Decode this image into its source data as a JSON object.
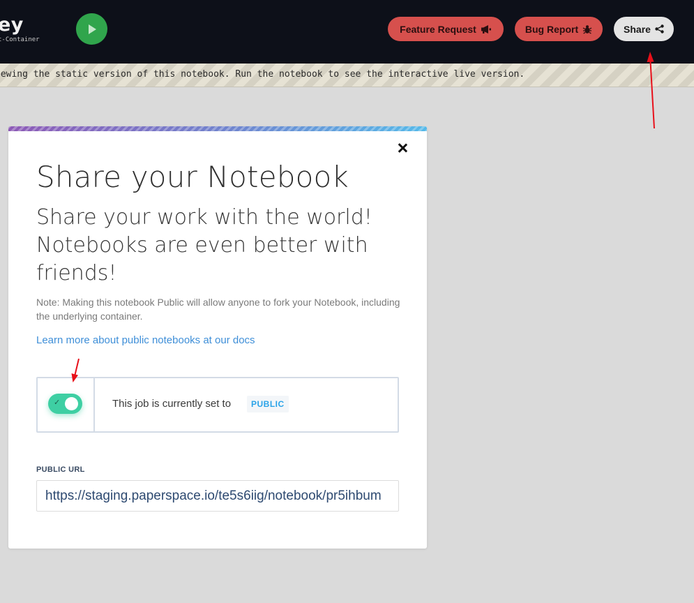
{
  "header": {
    "title": "ey",
    "subtitle": "t-Container",
    "run_button_icon": "play-icon",
    "buttons": {
      "feature_request": "Feature Request",
      "bug_report": "Bug Report",
      "share": "Share"
    }
  },
  "notice": {
    "text": "iewing the static version of this notebook. Run the notebook to see the interactive live version."
  },
  "modal": {
    "title": "Share your Notebook",
    "subtitle": "Share your work with the world! Notebooks are even better with friends!",
    "note": "Note: Making this notebook Public will allow anyone to fork your Notebook, including the underlying container.",
    "docs_link": "Learn more about public notebooks at our docs",
    "visibility": {
      "label": "This job is currently set to",
      "status": "PUBLIC",
      "toggle_on": true
    },
    "public_url": {
      "label": "PUBLIC URL",
      "value": "https://staging.paperspace.io/te5s6iig/notebook/pr5ihbum"
    }
  },
  "colors": {
    "topbar_bg": "#0d1019",
    "run_button": "#30a54c",
    "red_button": "#d6504d",
    "toggle_on": "#3ecfa3",
    "link": "#3f8fd8",
    "badge_text": "#2aa3e8",
    "annotation_arrow": "#e8101a"
  }
}
